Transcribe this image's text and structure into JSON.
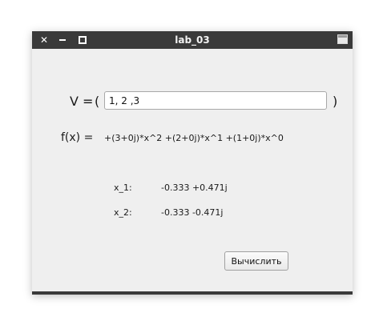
{
  "window": {
    "title": "lab_03",
    "close_glyph": "✕"
  },
  "form": {
    "v_label": "V =",
    "paren_open": "(",
    "paren_close": ")",
    "v_input_value": "1, 2 ,3",
    "fx_label": "f(x) =",
    "fx_value": "+(3+0j)*x^2 +(2+0j)*x^1 +(1+0j)*x^0",
    "x1_label": "x_1:",
    "x1_value": "-0.333 +0.471j",
    "x2_label": "x_2:",
    "x2_value": "-0.333 -0.471j",
    "calc_button_label": "Вычислить"
  },
  "colors": {
    "titlebar": "#3a3a3a",
    "window_bg": "#efefef"
  },
  "icons": [
    "close-icon",
    "minimize-icon",
    "maximize-icon",
    "window-menu-icon"
  ]
}
